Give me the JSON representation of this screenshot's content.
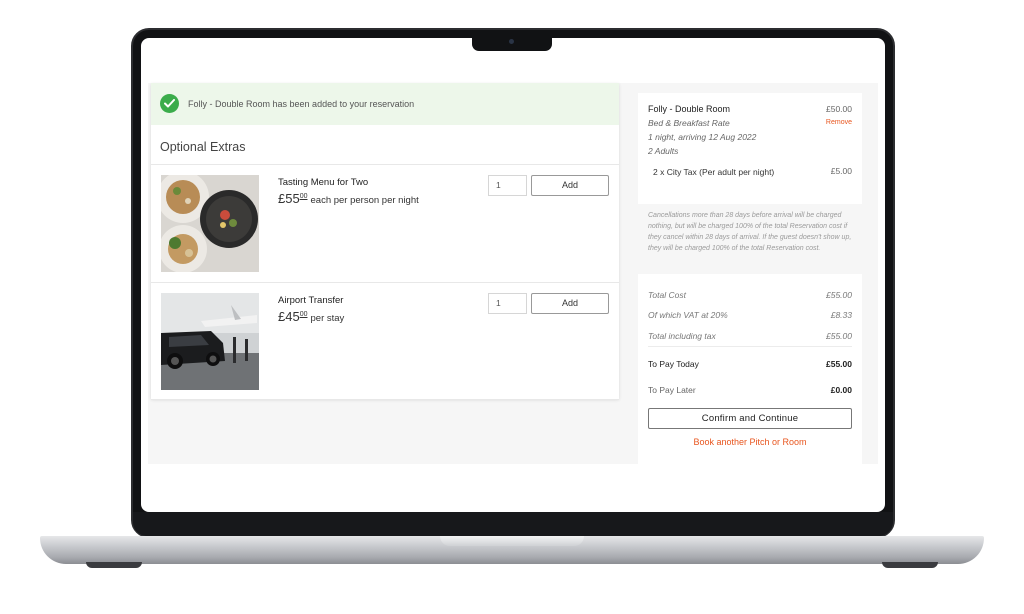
{
  "banner": {
    "message": "Folly - Double Room has been added to your reservation"
  },
  "extras": {
    "title": "Optional Extras",
    "items": [
      {
        "name": "Tasting Menu for Two",
        "price_main": "£55",
        "price_dec": "00",
        "price_unit": "each per person per night",
        "qty": "1",
        "add_label": "Add"
      },
      {
        "name": "Airport Transfer",
        "price_main": "£45",
        "price_dec": "00",
        "price_unit": "per stay",
        "qty": "1",
        "add_label": "Add"
      }
    ]
  },
  "summary": {
    "room_name": "Folly - Double Room",
    "room_price": "£50.00",
    "rate": "Bed & Breakfast Rate",
    "remove_label": "Remove",
    "nights": "1 night, arriving 12 Aug 2022",
    "adults": "2 Adults",
    "tax_label": "2 x City Tax (Per adult per night)",
    "tax_price": "£5.00",
    "policy": "Cancellations more than 28 days before arrival will be charged nothing, but will be charged 100% of the total Reservation cost if they cancel within 28 days of arrival. If the guest doesn't show up, they will be charged 100% of the total Reservation cost.",
    "total_cost_label": "Total Cost",
    "total_cost": "£55.00",
    "vat_label": "Of which VAT at 20%",
    "vat": "£8.33",
    "total_tax_label": "Total including tax",
    "total_tax": "£55.00",
    "pay_today_label": "To Pay Today",
    "pay_today": "£55.00",
    "pay_later_label": "To Pay Later",
    "pay_later": "£0.00",
    "confirm_label": "Confirm and Continue",
    "book_another_label": "Book another Pitch or Room"
  },
  "colors": {
    "accent": "#e8561f",
    "success": "#3bac4b",
    "banner_bg": "#edf7ea"
  },
  "icons": {
    "banner": "check-circle-icon"
  }
}
